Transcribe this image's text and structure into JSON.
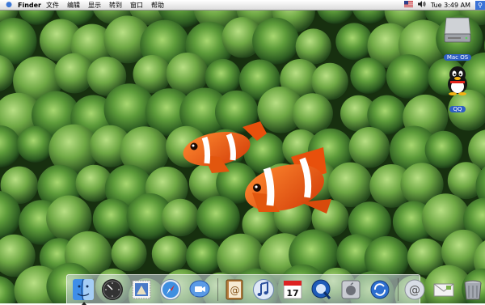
{
  "menubar": {
    "apple_icon": "apple-icon",
    "app_name": "Finder",
    "menus": [
      "文件",
      "编辑",
      "显示",
      "转到",
      "窗口",
      "帮助"
    ],
    "status": {
      "flag_icon": "us-flag-icon",
      "volume_icon": "volume-icon",
      "clock": "Tue 3:49 AM",
      "spotlight_icon": "spotlight-icon"
    }
  },
  "desktop": {
    "icons": [
      {
        "label": "Mac OS",
        "icon": "hard-drive-icon"
      },
      {
        "label": "QQ",
        "icon": "qq-penguin-icon"
      }
    ]
  },
  "dock": {
    "items": [
      {
        "name": "finder",
        "icon": "finder-icon",
        "running": true
      },
      {
        "name": "dashboard",
        "icon": "dashboard-icon",
        "running": false
      },
      {
        "name": "mail",
        "icon": "mail-stamp-icon",
        "running": false
      },
      {
        "name": "safari",
        "icon": "safari-compass-icon",
        "running": false
      },
      {
        "name": "ichat",
        "icon": "ichat-video-icon",
        "running": false
      },
      {
        "name": "address-book",
        "icon": "address-book-icon",
        "running": false
      },
      {
        "name": "itunes",
        "icon": "itunes-note-icon",
        "running": false
      },
      {
        "name": "ical",
        "icon": "ical-calendar-icon",
        "running": false,
        "date": "17"
      },
      {
        "name": "quicktime",
        "icon": "quicktime-icon",
        "running": false
      },
      {
        "name": "system-prefs",
        "icon": "apple-prefs-icon",
        "running": false
      },
      {
        "name": "sync",
        "icon": "sync-icon",
        "running": false
      },
      {
        "name": "network",
        "icon": "at-sign-icon",
        "running": false
      },
      {
        "name": "mail-doc",
        "icon": "mail-envelope-icon",
        "running": false
      },
      {
        "name": "trash",
        "icon": "trash-icon",
        "running": false
      }
    ]
  },
  "colors": {
    "menubar_bg": "#e8e8e8",
    "label_bg": "#2e5fc2",
    "anemone_green": "#5a9a3a",
    "clownfish_orange": "#f05a10"
  }
}
